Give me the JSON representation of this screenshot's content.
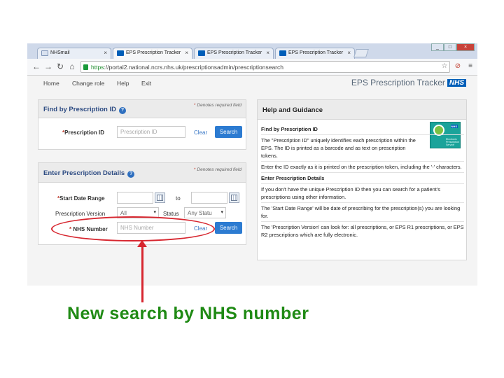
{
  "browser": {
    "tabs": [
      {
        "label": "NHSmail",
        "close": "×"
      },
      {
        "label": "EPS Prescription Tracker",
        "close": "×"
      },
      {
        "label": "EPS Prescription Tracker",
        "close": "×"
      },
      {
        "label": "EPS Prescription Tracker",
        "close": "×"
      }
    ],
    "url_https": "https",
    "url_rest": "://portal2.national.ncrs.nhs.uk/prescriptionsadmin/prescriptionsearch",
    "nav": {
      "back": "←",
      "forward": "→",
      "reload": "↻",
      "home": "⌂"
    },
    "window": {
      "minimize": "_",
      "maximize": "□",
      "close": "×"
    },
    "icons": [
      "back-arrow-icon",
      "forward-arrow-icon",
      "reload-icon",
      "home-icon",
      "star-icon",
      "stop-icon",
      "menu-icon"
    ]
  },
  "nav": {
    "home": "Home",
    "change_role": "Change role",
    "help": "Help",
    "exit": "Exit"
  },
  "brand": {
    "title": "EPS Prescription Tracker",
    "nhs": "NHS"
  },
  "find_panel": {
    "title": "Find by Prescription ID",
    "required_note": "Denotes required field",
    "field_label": "Prescription ID",
    "placeholder": "Prescription ID",
    "clear": "Clear",
    "search": "Search"
  },
  "details_panel": {
    "title": "Enter Prescription Details",
    "required_note": "Denotes required field",
    "start_date_label": "Start Date Range",
    "to": "to",
    "version_label": "Prescription Version",
    "version_value": "All",
    "status_label": "Status",
    "status_value": "Any Statu",
    "nhs_label": "NHS Number",
    "nhs_placeholder": "NHS Number",
    "clear": "Clear",
    "search": "Search"
  },
  "help_panel": {
    "title": "Help and Guidance",
    "find_heading": "Find by Prescription ID",
    "find_text": "The \"Prescription ID\" uniquely identifies each prescription within the EPS. The ID is printed as a barcode and as text on prescription tokens.",
    "find_text2": "Enter the ID exactly as it is printed on the prescription token, including the '-' characters.",
    "details_heading": "Enter Prescription Details",
    "details_text": "If you don't have the unique Prescription ID then you can search for a patient's prescriptions using other information.",
    "date_text": "The 'Start Date Range' will be date of prescribing for the prescription(s) you are looking for.",
    "version_text": "The 'Prescription Version' can look for: all prescriptions, or EPS R1 prescriptions, or EPS R2 prescriptions which are fully electronic.",
    "logo_nhs": "NHS",
    "logo_lines": [
      "Electronic",
      "Prescription",
      "Service"
    ]
  },
  "annotation": {
    "caption": "New search by NHS number",
    "color": "#d7262f",
    "caption_color": "#1f8a14"
  }
}
